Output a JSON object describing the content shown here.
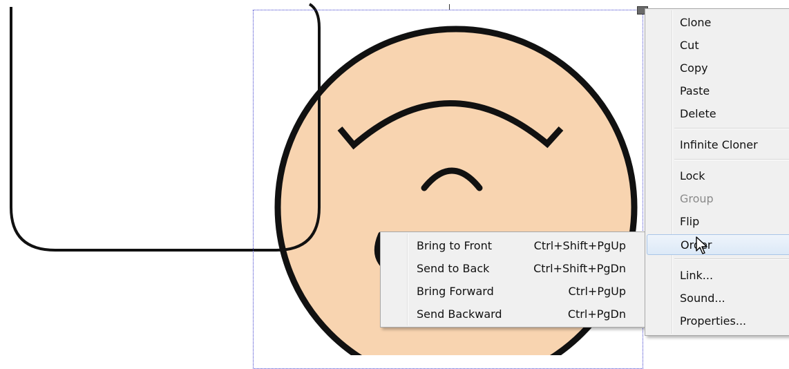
{
  "context_menu": {
    "items": [
      {
        "label": "Clone",
        "enabled": true
      },
      {
        "label": "Cut",
        "enabled": true
      },
      {
        "label": "Copy",
        "enabled": true
      },
      {
        "label": "Paste",
        "enabled": true
      },
      {
        "label": "Delete",
        "enabled": true
      },
      {
        "label": "Infinite Cloner",
        "enabled": true
      },
      {
        "label": "Lock",
        "enabled": true
      },
      {
        "label": "Group",
        "enabled": false
      },
      {
        "label": "Flip",
        "enabled": true
      },
      {
        "label": "Order",
        "enabled": true,
        "highlighted": true,
        "has_submenu": true
      },
      {
        "label": "Link...",
        "enabled": true
      },
      {
        "label": "Sound...",
        "enabled": true
      },
      {
        "label": "Properties...",
        "enabled": true
      }
    ]
  },
  "order_submenu": {
    "items": [
      {
        "label": "Bring to Front",
        "shortcut": "Ctrl+Shift+PgUp"
      },
      {
        "label": "Send to Back",
        "shortcut": "Ctrl+Shift+PgDn"
      },
      {
        "label": "Bring Forward",
        "shortcut": "Ctrl+PgUp"
      },
      {
        "label": "Send Backward",
        "shortcut": "Ctrl+PgDn"
      }
    ]
  },
  "colors": {
    "face_fill": "#f8d4b0",
    "outline": "#111111",
    "selection_border": "#3a3acc",
    "menu_background": "#f0f0f0",
    "highlight_border": "#a9c5e8"
  },
  "icons": {
    "cursor": "arrow-pointer-icon",
    "selection_handle": "resize-handle-icon"
  }
}
